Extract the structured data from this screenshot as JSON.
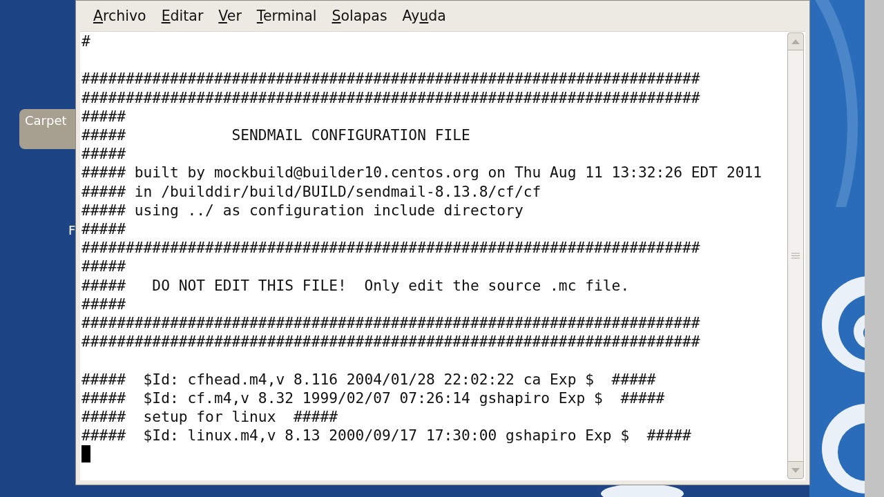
{
  "desktop": {
    "icons": [
      {
        "label": "Carpet"
      },
      {
        "label": "F"
      }
    ]
  },
  "window": {
    "menu": [
      {
        "mnemonic": "A",
        "rest": "rchivo"
      },
      {
        "mnemonic": "E",
        "rest": "ditar"
      },
      {
        "mnemonic": "V",
        "rest": "er"
      },
      {
        "mnemonic": "T",
        "rest": "erminal"
      },
      {
        "mnemonic": "S",
        "rest": "olapas"
      },
      {
        "prefix": "Ay",
        "mnemonic": "u",
        "rest": "da"
      }
    ]
  },
  "terminal": {
    "blocks": [
      [
        "#"
      ],
      [
        "######################################################################",
        "######################################################################",
        "#####",
        "#####            SENDMAIL CONFIGURATION FILE",
        "#####",
        "##### built by mockbuild@builder10.centos.org on Thu Aug 11 13:32:26 EDT 2011",
        "##### in /builddir/build/BUILD/sendmail-8.13.8/cf/cf",
        "##### using ../ as configuration include directory",
        "#####",
        "######################################################################",
        "#####",
        "#####   DO NOT EDIT THIS FILE!  Only edit the source .mc file.",
        "#####",
        "######################################################################",
        "######################################################################"
      ],
      [
        "#####  $Id: cfhead.m4,v 8.116 2004/01/28 22:02:22 ca Exp $  #####",
        "#####  $Id: cf.m4,v 8.32 1999/02/07 07:26:14 gshapiro Exp $  #####",
        "#####  setup for linux  #####",
        "#####  $Id: linux.m4,v 8.13 2000/09/17 17:30:00 gshapiro Exp $  #####"
      ]
    ],
    "cursor": true
  }
}
